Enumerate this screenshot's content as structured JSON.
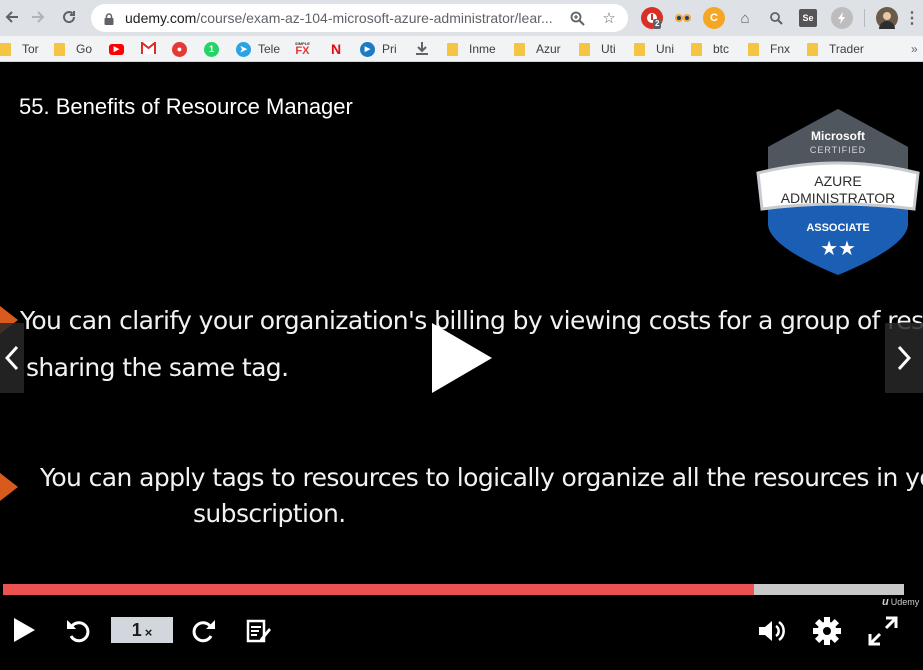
{
  "browser": {
    "url_host": "udemy.com",
    "url_path": "/course/exam-az-104-microsoft-azure-administrator/lear...",
    "extensions": [
      {
        "name": "ext-badge",
        "badge": "2",
        "color": "#d93025"
      },
      {
        "name": "ext-owl",
        "color": "#4a90d9"
      },
      {
        "name": "ext-coin",
        "label": "C",
        "color": "#f5a623"
      },
      {
        "name": "ext-home"
      },
      {
        "name": "ext-search"
      },
      {
        "name": "ext-se",
        "label": "Se",
        "color": "#555555"
      },
      {
        "name": "ext-bolt"
      },
      {
        "name": "profile-avatar"
      }
    ]
  },
  "bookmarks": [
    {
      "type": "folder",
      "label": "Tor"
    },
    {
      "type": "folder",
      "label": "Go"
    },
    {
      "type": "youtube",
      "label": ""
    },
    {
      "type": "gmail",
      "label": ""
    },
    {
      "type": "record",
      "label": ""
    },
    {
      "type": "whatsapp",
      "label": ""
    },
    {
      "type": "telegram",
      "label": "Tele"
    },
    {
      "type": "simplefx",
      "label": ""
    },
    {
      "type": "netflix",
      "label": ""
    },
    {
      "type": "prime",
      "label": "Pri"
    },
    {
      "type": "download",
      "label": ""
    },
    {
      "type": "folder",
      "label": "Inme"
    },
    {
      "type": "folder",
      "label": "Azur"
    },
    {
      "type": "folder",
      "label": "Uti"
    },
    {
      "type": "folder",
      "label": "Uni"
    },
    {
      "type": "folder",
      "label": "btc"
    },
    {
      "type": "folder",
      "label": "Fnx"
    },
    {
      "type": "folder",
      "label": "Trader"
    }
  ],
  "bookmark_icon_text": {
    "simplefx_top": "SIMPLE",
    "simplefx": "FX",
    "netflix": "N"
  },
  "video": {
    "title": "55. Benefits of Resource Manager",
    "badge": {
      "top": "Microsoft",
      "sub": "CERTIFIED",
      "line1": "AZURE",
      "line2": "ADMINISTRATOR",
      "level": "ASSOCIATE",
      "stars": "★★"
    },
    "bullets": [
      {
        "line1": "You can clarify your organization's billing by viewing costs for a group of resources",
        "line2": "sharing the same tag."
      },
      {
        "line1": "You can apply tags to resources to logically organize all the resources in your",
        "line2": "subscription."
      }
    ],
    "progress_fraction": 0.833,
    "watermark": "Udemy",
    "speed": "1",
    "speed_suffix": "×"
  },
  "colors": {
    "accent": "#ec5252",
    "bullet": "#d85a1c",
    "badge_blue": "#1b5fb4"
  }
}
